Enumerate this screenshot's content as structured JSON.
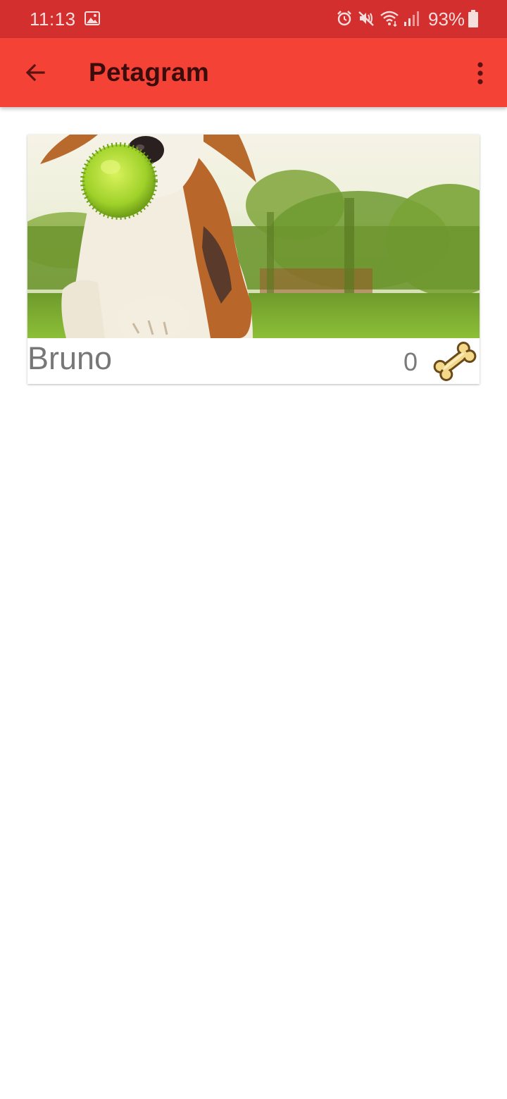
{
  "status_bar": {
    "time": "11:13",
    "battery": "93%",
    "icons": [
      "image-icon",
      "alarm-icon",
      "mute-icon",
      "wifi-icon",
      "signal-icon",
      "battery-icon"
    ]
  },
  "app_bar": {
    "title": "Petagram",
    "back_icon": "arrow-back-icon",
    "menu_icon": "more-vert-icon",
    "background_color": "#f44336",
    "status_color": "#d32f2f"
  },
  "pet_card": {
    "name": "Bruno",
    "likes": "0",
    "like_icon": "bone-icon",
    "photo_subject": "dog-photo"
  }
}
